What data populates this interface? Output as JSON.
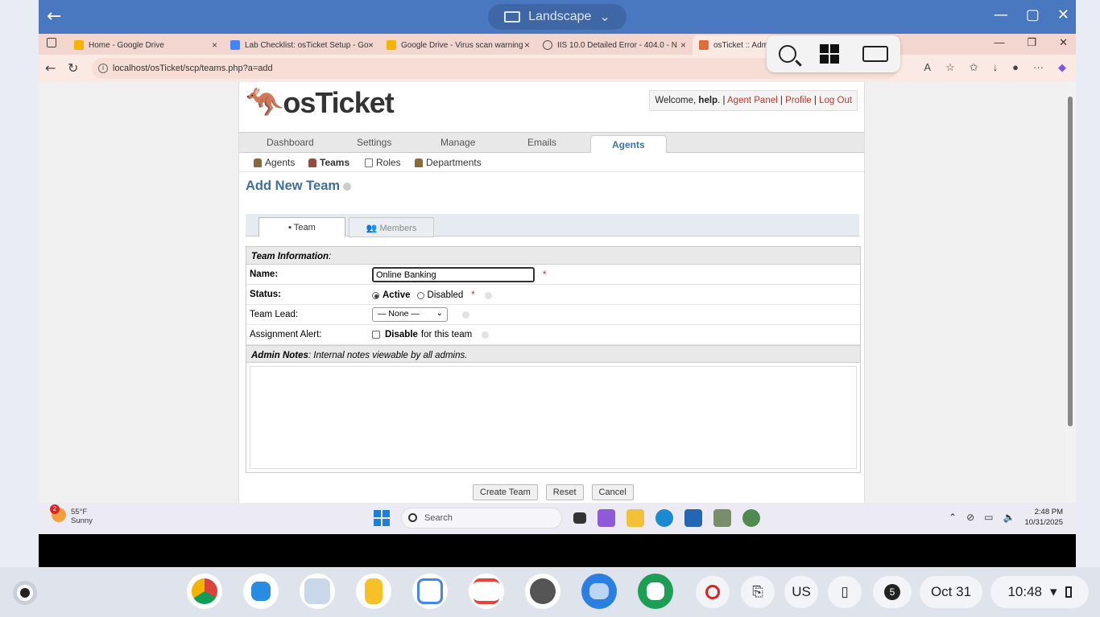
{
  "remote": {
    "mode_label": "Landscape",
    "controls": [
      "—",
      "▢",
      "✕"
    ]
  },
  "browser": {
    "tabs": [
      {
        "label": "Home - Google Drive",
        "color": "#f4b400"
      },
      {
        "label": "Lab Checklist: osTicket Setup - Go",
        "color": "#4285f4"
      },
      {
        "label": "Google Drive - Virus scan warning",
        "color": "#f4b400"
      },
      {
        "label": "IIS 10.0 Detailed Error - 404.0 - N",
        "color": "#555555"
      },
      {
        "label": "osTicket :: Admi",
        "color": "#e06c3c"
      }
    ],
    "url": "localhost/osTicket/scp/teams.php?a=add"
  },
  "osticket": {
    "logo_text": "osTicket",
    "welcome": {
      "prefix": "Welcome, ",
      "user": "help",
      "sep": ". | ",
      "agent_panel": "Agent Panel",
      "profile": "Profile",
      "logout": "Log Out"
    },
    "nav": [
      "Dashboard",
      "Settings",
      "Manage",
      "Emails",
      "Agents"
    ],
    "subnav": [
      "Agents",
      "Teams",
      "Roles",
      "Departments"
    ],
    "page_title": "Add New Team",
    "form_tabs": {
      "team": "Team",
      "members": "Members"
    },
    "form": {
      "section_header": "Team Information",
      "name_label": "Name:",
      "name_value": "Online Banking",
      "status_label": "Status:",
      "status_active": "Active",
      "status_disabled": "Disabled",
      "team_lead_label": "Team Lead:",
      "team_lead_value": "— None —",
      "alert_label": "Assignment Alert:",
      "alert_disable": "Disable",
      "alert_suffix": "for this team",
      "notes_header": "Admin Notes",
      "notes_hint": ": Internal notes viewable by all admins.",
      "required_mark": "*"
    },
    "buttons": {
      "create": "Create Team",
      "reset": "Reset",
      "cancel": "Cancel"
    }
  },
  "windows_taskbar": {
    "weather_badge": "2",
    "temperature": "55°F",
    "condition": "Sunny",
    "search_placeholder": "Search",
    "time": "2:48 PM",
    "date": "10/31/2025"
  },
  "chromeos_shelf": {
    "keyboard_layout": "US",
    "notification_count": "5",
    "date": "Oct 31",
    "time": "10:48"
  }
}
